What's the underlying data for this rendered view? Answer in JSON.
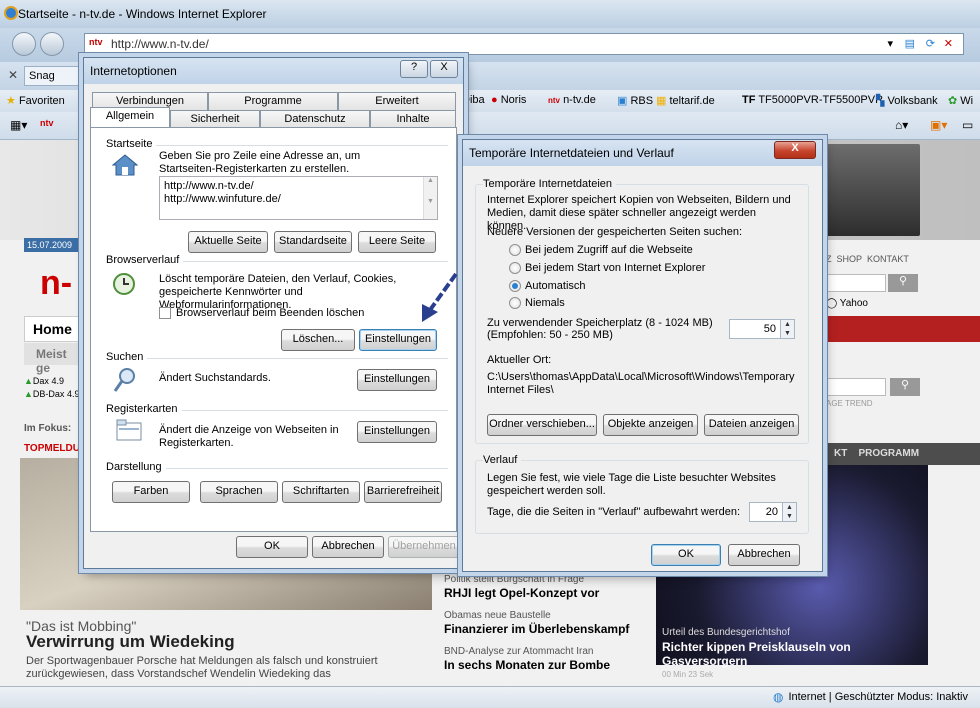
{
  "browser": {
    "window_title": "Startseite - n-tv.de - Windows Internet Explorer",
    "url": "http://www.n-tv.de/",
    "site_badge": "ntv",
    "tab_label": "Snag",
    "favorites_label": "Favoriten",
    "favorites": [
      "Diba",
      "Noris",
      "n-tv.de",
      "RBS",
      "teltarif.de",
      "TF5000PVR-TF5500PVR",
      "Volksbank",
      "Wi"
    ],
    "status_zone": "Internet | Geschützter Modus: Inaktiv"
  },
  "site": {
    "date": "15.07.2009",
    "logo": "n-",
    "nav": [
      "Home",
      "Meist ge"
    ],
    "shop_links": [
      "Z",
      "SHOP",
      "KONTAKT"
    ],
    "yahoo": "Yahoo",
    "ticker": [
      {
        "name": "Dax",
        "value": "4.9"
      },
      {
        "name": "DB-Dax",
        "value": "4.9"
      }
    ],
    "im_fokus": "Im Fokus:",
    "topmeldung": "TOPMELDU",
    "trend_label": "AGE TREND",
    "tab_kt": "KT",
    "programm": "PROGRAMM",
    "headline_kicker": "\"Das ist Mobbing\"",
    "headline_title": "Verwirrung um Wiedeking",
    "headline_text": "Der Sportwagenbauer Porsche hat Meldungen als falsch und konstruiert zurückgewiesen, dass Vorstandschef Wendelin Wiedeking das",
    "mid_news": [
      {
        "kicker": "Politik stellt Bürgschaft in Frage",
        "title": "RHJI legt Opel-Konzept vor"
      },
      {
        "kicker": "Obamas neue Baustelle",
        "title": "Finanzierer im Überlebenskampf"
      },
      {
        "kicker": "BND-Analyse zur Atommacht Iran",
        "title": "In sechs Monaten zur Bombe"
      }
    ],
    "right_kicker": "Urteil des Bundesgerichtshof",
    "right_title": "Richter kippen Preisklauseln von Gasversorgern",
    "right_time": "00 Min 23 Sek"
  },
  "internetoptionen": {
    "title": "Internetoptionen",
    "help": "?",
    "close": "X",
    "tabs_row1": [
      "Verbindungen",
      "Programme",
      "Erweitert"
    ],
    "tabs_row2": [
      "Allgemein",
      "Sicherheit",
      "Datenschutz",
      "Inhalte"
    ],
    "startseite": {
      "group": "Startseite",
      "desc": "Geben Sie pro Zeile eine Adresse an, um Startseiten-Registerkarten zu erstellen.",
      "urls": [
        "http://www.n-tv.de/",
        "http://www.winfuture.de/"
      ],
      "btn_current": "Aktuelle Seite",
      "btn_default": "Standardseite",
      "btn_blank": "Leere Seite"
    },
    "verlauf": {
      "group": "Browserverlauf",
      "desc": "Löscht temporäre Dateien, den Verlauf, Cookies, gespeicherte Kennwörter und Webformularinformationen.",
      "checkbox": "Browserverlauf beim Beenden löschen",
      "btn_delete": "Löschen...",
      "btn_settings": "Einstellungen"
    },
    "suchen": {
      "group": "Suchen",
      "desc": "Ändert Suchstandards.",
      "btn": "Einstellungen"
    },
    "register": {
      "group": "Registerkarten",
      "desc": "Ändert die Anzeige von Webseiten in Registerkarten.",
      "btn": "Einstellungen"
    },
    "darstellung": {
      "group": "Darstellung",
      "buttons": [
        "Farben",
        "Sprachen",
        "Schriftarten",
        "Barrierefreiheit"
      ]
    },
    "ok": "OK",
    "cancel": "Abbrechen",
    "apply": "Übernehmen"
  },
  "temp_dialog": {
    "title": "Temporäre Internetdateien und Verlauf",
    "close": "X",
    "temp_group": "Temporäre Internetdateien",
    "temp_desc": "Internet Explorer speichert Kopien von Webseiten, Bildern und Medien, damit diese später schneller angezeigt werden können.",
    "check_label": "Neuere Versionen der gespeicherten Seiten suchen:",
    "radios": [
      "Bei jedem Zugriff auf die Webseite",
      "Bei jedem Start von Internet Explorer",
      "Automatisch",
      "Niemals"
    ],
    "selected_radio": 2,
    "space_label": "Zu verwendender Speicherplatz (8 - 1024 MB)",
    "space_hint": "(Empfohlen: 50 - 250 MB)",
    "space_value": "50",
    "location_label": "Aktueller Ort:",
    "location_path": "C:\\Users\\thomas\\AppData\\Local\\Microsoft\\Windows\\Temporary Internet Files\\",
    "btn_move": "Ordner verschieben...",
    "btn_objects": "Objekte anzeigen",
    "btn_files": "Dateien anzeigen",
    "history_group": "Verlauf",
    "history_desc": "Legen Sie fest, wie viele Tage die Liste besuchter Websites gespeichert werden soll.",
    "days_label": "Tage, die die Seiten in \"Verlauf\" aufbewahrt werden:",
    "days_value": "20",
    "ok": "OK",
    "cancel": "Abbrechen"
  }
}
